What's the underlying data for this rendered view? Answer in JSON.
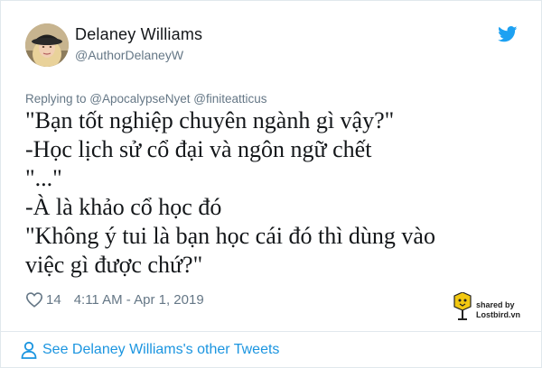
{
  "author": {
    "display_name": "Delaney Williams",
    "handle": "@AuthorDelaneyW"
  },
  "reply_context": "Replying to @ApocalypseNyet @finiteatticus",
  "tweet_lines": [
    "\"Bạn tốt nghiệp chuyên ngành gì vậy?\"",
    "-Học lịch sử cổ đại và ngôn ngữ chết",
    "\"...\"",
    "-À là khảo cổ học đó",
    "\"Không ý tui là bạn học cái đó thì dùng vào",
    "việc gì được chứ?\""
  ],
  "meta": {
    "like_count": "14",
    "timestamp": "4:11 AM - Apr 1, 2019"
  },
  "badge": {
    "line1": "shared by",
    "line2": "Lostbird.vn"
  },
  "footer": {
    "other_tweets_label": "See Delaney Williams's other Tweets"
  },
  "icons": {
    "brand": "twitter-bird-icon",
    "like": "heart-icon",
    "profile": "person-icon",
    "badge": "lostbird-logo-icon"
  },
  "colors": {
    "twitter_blue": "#1da1f2",
    "link_blue": "#1b95e0",
    "muted_gray": "#657786",
    "text": "#14171a",
    "border": "#e1e8ed"
  }
}
